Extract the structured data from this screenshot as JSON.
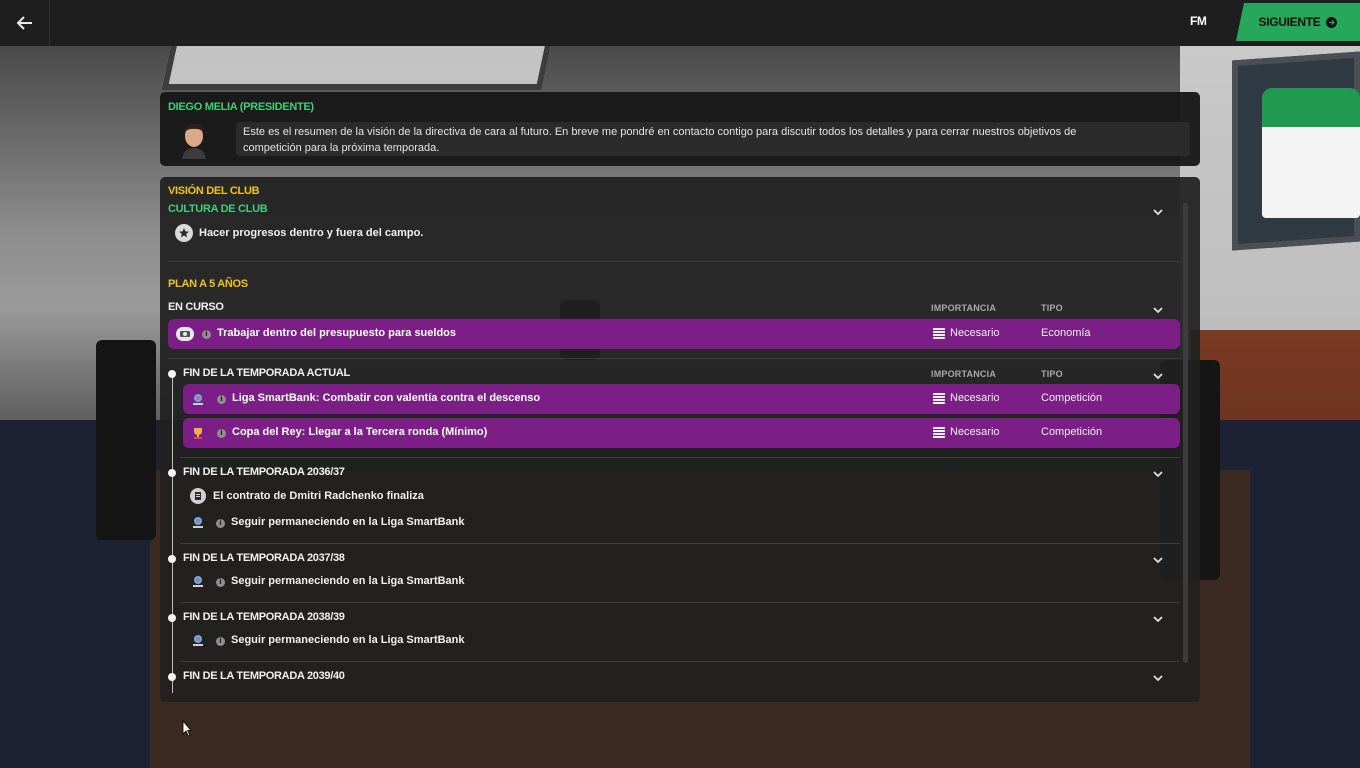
{
  "topbar": {
    "back_icon": "arrow-left-icon",
    "logo": "FM",
    "next_label": "SIGUIENTE",
    "next_icon": "arrow-right-circle-icon",
    "next_color": "#25a85a"
  },
  "president": {
    "name": "DIEGO MELIA (PRESIDENTE)",
    "message_line1": "Este es el resumen de la visión de la directiva de cara al futuro. En breve me pondré en contacto contigo para discutir todos los detalles y para cerrar nuestros objetivos de",
    "message_line2": "competición para la próxima temporada."
  },
  "vision": {
    "title": "VISIÓN DEL CLUB",
    "culture_heading": "CULTURA DE CLUB",
    "culture_item": "Hacer progresos dentro y fuera del campo.",
    "plan_heading": "PLAN A 5 AÑOS",
    "in_progress": {
      "heading": "EN CURSO",
      "col_importance": "IMPORTANCIA",
      "col_type": "TIPO",
      "objectives": [
        {
          "text": "Trabajar dentro del presupuesto para sueldos",
          "importance": "Necesario",
          "type": "Economía"
        }
      ]
    },
    "current_season": {
      "heading": "FIN DE LA TEMPORADA ACTUAL",
      "col_importance": "IMPORTANCIA",
      "col_type": "TIPO",
      "objectives": [
        {
          "text": "Liga SmartBank: Combatir con valentía contra el descenso",
          "importance": "Necesario",
          "type": "Competición"
        },
        {
          "text": "Copa del Rey: Llegar a la Tercera ronda (Mínimo)",
          "importance": "Necesario",
          "type": "Competición"
        }
      ]
    },
    "future_seasons": [
      {
        "heading": "FIN DE LA TEMPORADA 2036/37",
        "items": [
          "El contrato de Dmitri Radchenko finaliza",
          "Seguir permaneciendo en la Liga SmartBank"
        ]
      },
      {
        "heading": "FIN DE LA TEMPORADA 2037/38",
        "items": [
          "Seguir permaneciendo en la Liga SmartBank"
        ]
      },
      {
        "heading": "FIN DE LA TEMPORADA 2038/39",
        "items": [
          "Seguir permaneciendo en la Liga SmartBank"
        ]
      },
      {
        "heading": "FIN DE LA TEMPORADA 2039/40",
        "items": []
      }
    ],
    "objective_row_color": "#7b1f86",
    "heading_color_yellow": "#f0c419",
    "heading_color_green": "#3fcf78"
  }
}
